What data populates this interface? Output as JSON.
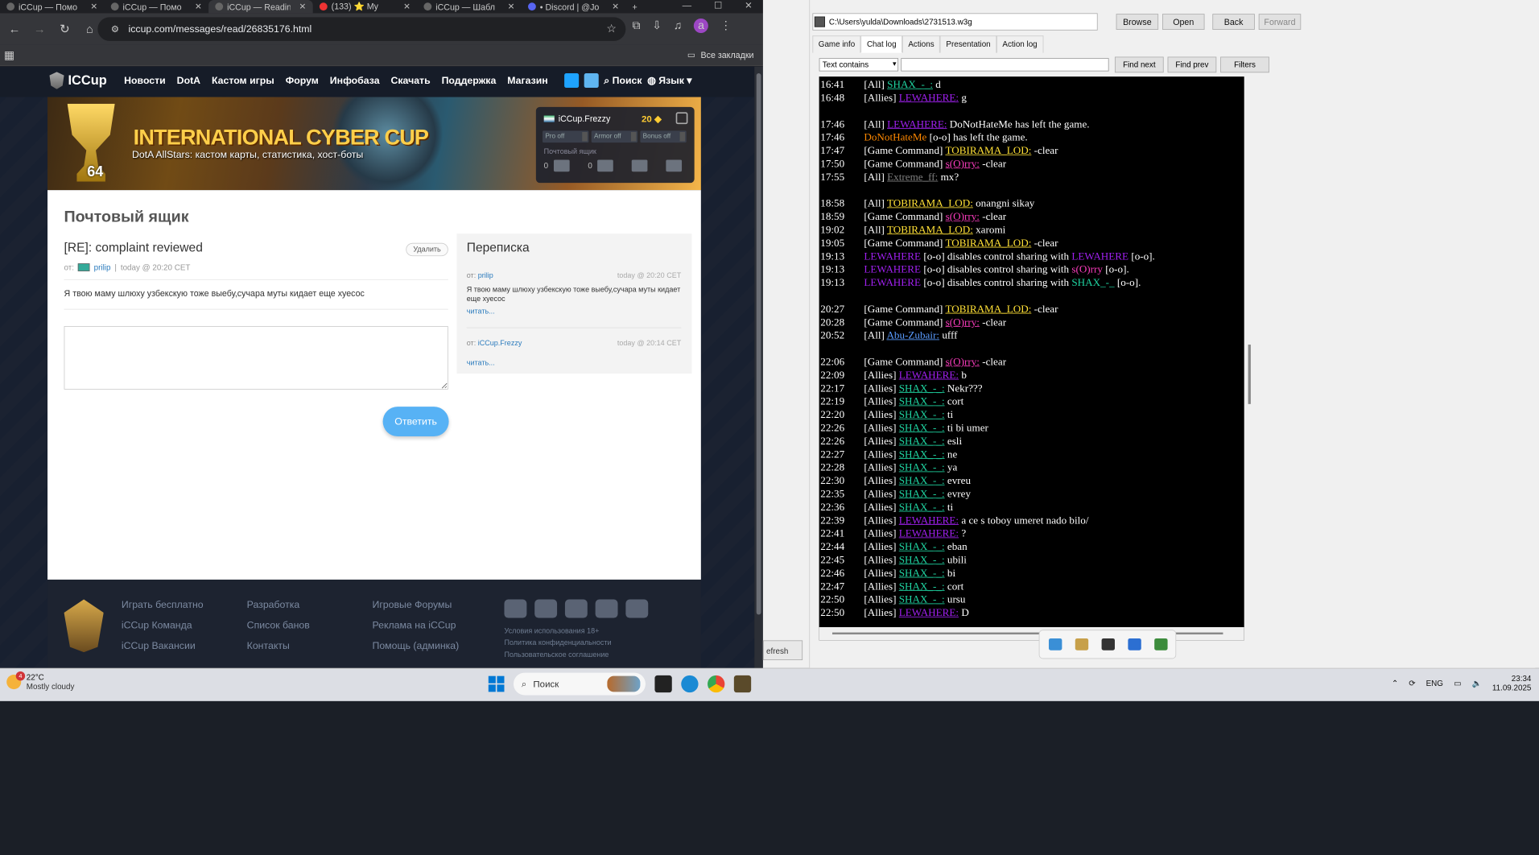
{
  "browser": {
    "tabs": [
      {
        "label": "iCCup — Помо"
      },
      {
        "label": "iCCup — Помо"
      },
      {
        "label": "iCCup — Readin"
      },
      {
        "label": "(133) ⭐ My"
      },
      {
        "label": "iCCup — Шабл"
      },
      {
        "label": "• Discord | @Jo"
      }
    ],
    "url": "iccup.com/messages/read/26835176.html",
    "all_bookmarks": "Все закладки",
    "avatar_letter": "a"
  },
  "site": {
    "logo": "ICCup",
    "menu": [
      "Новости",
      "DotA",
      "Кастом игры",
      "Форум",
      "Инфобаза",
      "Скачать",
      "Поддержка",
      "Магазин"
    ],
    "search": "Поиск",
    "lang": "Язык",
    "banner_title": "INTERNATIONAL CYBER CUP",
    "banner_subtitle": "DotA AllStars: кастом карты, статистика, хост-боты",
    "banner_num": "64",
    "user": {
      "name": "iCCup.Frezzy",
      "gold": "20",
      "toggles": [
        "Pro off",
        "Armor off",
        "Bonus off"
      ],
      "mailbox_label": "Почтовый ящик",
      "mail_count": "0",
      "warn_count": "0"
    },
    "mailbox": {
      "title": "Почтовый ящик",
      "subject": "[RE]: complaint reviewed",
      "delete_label": "Удалить",
      "from_label": "от:",
      "from": "prilip",
      "time": "today @ 20:20 CET",
      "body": "Я твою маму шлюху узбекскую тоже выебу,сучара муты кидает еще хуесос",
      "reply_label": "Ответить"
    },
    "thread": {
      "title": "Переписка",
      "items": [
        {
          "from_label": "от:",
          "from": "prilip",
          "time": "today @ 20:20 CET",
          "text": "Я твою маму шлюху узбекскую тоже выебу,сучара муты кидает еще хуесос",
          "read": "читать..."
        },
        {
          "from_label": "от:",
          "from": "iCCup.Frezzy",
          "time": "today @ 20:14 CET",
          "text": "",
          "read": "читать..."
        }
      ]
    },
    "footer": {
      "col1": [
        "Играть бесплатно",
        "iCCup Команда",
        "iCCup Вакансии"
      ],
      "col2": [
        "Разработка",
        "Список банов",
        "Контакты"
      ],
      "col3": [
        "Игровые Форумы",
        "Реклама на iCCup",
        "Помощь (админка)"
      ],
      "legal": [
        "Условия использования 18+",
        "Политика конфиденциальности",
        "Пользовательское соглашение"
      ]
    }
  },
  "replay": {
    "path": "C:\\Users\\yulda\\Downloads\\2731513.w3g",
    "buttons": [
      "Browse",
      "Open",
      "Back",
      "Forward"
    ],
    "tabs": [
      "Game info",
      "Chat log",
      "Actions",
      "Presentation",
      "Action log"
    ],
    "filter": "Text contains",
    "find_next": "Find next",
    "find_prev": "Find prev",
    "filters": "Filters",
    "refresh": "efresh",
    "chat": [
      {
        "t": "16:41",
        "ch": "[All]",
        "n": "SHAX_-_:",
        "c": "teal",
        "m": "d"
      },
      {
        "t": "16:48",
        "ch": "[Allies]",
        "n": "LEWAHERE:",
        "c": "purple",
        "m": "g"
      },
      {
        "gap": true
      },
      {
        "t": "17:46",
        "ch": "[All]",
        "n": "LEWAHERE:",
        "c": "purple",
        "m": "DoNotHateMe has left the game."
      },
      {
        "t": "17:46",
        "ch": "",
        "n": "DoNotHateMe",
        "c": "orange",
        "m": "[o-o] has left the game.",
        "plain": true
      },
      {
        "t": "17:47",
        "ch": "[Game Command]",
        "n": "TOBIRAMA_LOD:",
        "c": "gold",
        "m": "-clear"
      },
      {
        "t": "17:50",
        "ch": "[Game Command]",
        "n": "s(O)rry:",
        "c": "pink",
        "m": "-clear"
      },
      {
        "t": "17:55",
        "ch": "[All]",
        "n": "Extreme_ff:",
        "c": "gray",
        "m": "mx?"
      },
      {
        "gap": true
      },
      {
        "t": "18:58",
        "ch": "[All]",
        "n": "TOBIRAMA_LOD:",
        "c": "gold",
        "m": "onangni sikay"
      },
      {
        "t": "18:59",
        "ch": "[Game Command]",
        "n": "s(O)rry:",
        "c": "pink",
        "m": "-clear"
      },
      {
        "t": "19:02",
        "ch": "[All]",
        "n": "TOBIRAMA_LOD:",
        "c": "gold",
        "m": "xaromi"
      },
      {
        "t": "19:05",
        "ch": "[Game Command]",
        "n": "TOBIRAMA_LOD:",
        "c": "gold",
        "m": "-clear"
      },
      {
        "t": "19:13",
        "ch": "",
        "n": "LEWAHERE",
        "c": "purple",
        "m": "[o-o] disables control sharing with",
        "n2": "LEWAHERE",
        "c2": "purple",
        "m2": "[o-o].",
        "plain": true
      },
      {
        "t": "19:13",
        "ch": "",
        "n": "LEWAHERE",
        "c": "purple",
        "m": "[o-o] disables control sharing with",
        "n2": "s(O)rry",
        "c2": "pink",
        "m2": "[o-o].",
        "plain": true
      },
      {
        "t": "19:13",
        "ch": "",
        "n": "LEWAHERE",
        "c": "purple",
        "m": "[o-o] disables control sharing with",
        "n2": "SHAX_-_",
        "c2": "teal",
        "m2": "[o-o].",
        "plain": true
      },
      {
        "gap": true
      },
      {
        "t": "20:27",
        "ch": "[Game Command]",
        "n": "TOBIRAMA_LOD:",
        "c": "gold",
        "m": "-clear"
      },
      {
        "t": "20:28",
        "ch": "[Game Command]",
        "n": "s(O)rry:",
        "c": "pink",
        "m": "-clear"
      },
      {
        "t": "20:52",
        "ch": "[All]",
        "n": "Abu-Zubair:",
        "c": "blue",
        "m": "ufff"
      },
      {
        "gap": true
      },
      {
        "t": "22:06",
        "ch": "[Game Command]",
        "n": "s(O)rry:",
        "c": "pink",
        "m": "-clear"
      },
      {
        "t": "22:09",
        "ch": "[Allies]",
        "n": "LEWAHERE:",
        "c": "purple",
        "m": "b"
      },
      {
        "t": "22:17",
        "ch": "[Allies]",
        "n": "SHAX_-_:",
        "c": "teal",
        "m": "Nekr???"
      },
      {
        "t": "22:19",
        "ch": "[Allies]",
        "n": "SHAX_-_:",
        "c": "teal",
        "m": "cort"
      },
      {
        "t": "22:20",
        "ch": "[Allies]",
        "n": "SHAX_-_:",
        "c": "teal",
        "m": "ti"
      },
      {
        "t": "22:26",
        "ch": "[Allies]",
        "n": "SHAX_-_:",
        "c": "teal",
        "m": "ti bi umer"
      },
      {
        "t": "22:26",
        "ch": "[Allies]",
        "n": "SHAX_-_:",
        "c": "teal",
        "m": "esli"
      },
      {
        "t": "22:27",
        "ch": "[Allies]",
        "n": "SHAX_-_:",
        "c": "teal",
        "m": "ne"
      },
      {
        "t": "22:28",
        "ch": "[Allies]",
        "n": "SHAX_-_:",
        "c": "teal",
        "m": "ya"
      },
      {
        "t": "22:30",
        "ch": "[Allies]",
        "n": "SHAX_-_:",
        "c": "teal",
        "m": "evreu"
      },
      {
        "t": "22:35",
        "ch": "[Allies]",
        "n": "SHAX_-_:",
        "c": "teal",
        "m": "evrey"
      },
      {
        "t": "22:36",
        "ch": "[Allies]",
        "n": "SHAX_-_:",
        "c": "teal",
        "m": "ti"
      },
      {
        "t": "22:39",
        "ch": "[Allies]",
        "n": "LEWAHERE:",
        "c": "purple",
        "m": "a ce s toboy umeret nado bilo/"
      },
      {
        "t": "22:41",
        "ch": "[Allies]",
        "n": "LEWAHERE:",
        "c": "purple",
        "m": "?"
      },
      {
        "t": "22:44",
        "ch": "[Allies]",
        "n": "SHAX_-_:",
        "c": "teal",
        "m": "eban"
      },
      {
        "t": "22:45",
        "ch": "[Allies]",
        "n": "SHAX_-_:",
        "c": "teal",
        "m": "ubili"
      },
      {
        "t": "22:46",
        "ch": "[Allies]",
        "n": "SHAX_-_:",
        "c": "teal",
        "m": "bi"
      },
      {
        "t": "22:47",
        "ch": "[Allies]",
        "n": "SHAX_-_:",
        "c": "teal",
        "m": "cort"
      },
      {
        "t": "22:50",
        "ch": "[Allies]",
        "n": "SHAX_-_:",
        "c": "teal",
        "m": "ursu"
      },
      {
        "t": "22:50",
        "ch": "[Allies]",
        "n": "LEWAHERE:",
        "c": "purple",
        "m": "D"
      }
    ]
  },
  "taskbar": {
    "temp": "22°C",
    "weather": "Mostly cloudy",
    "badge": "4",
    "search": "Поиск",
    "lang": "ENG",
    "time": "23:34",
    "date": "11.09.2025"
  }
}
